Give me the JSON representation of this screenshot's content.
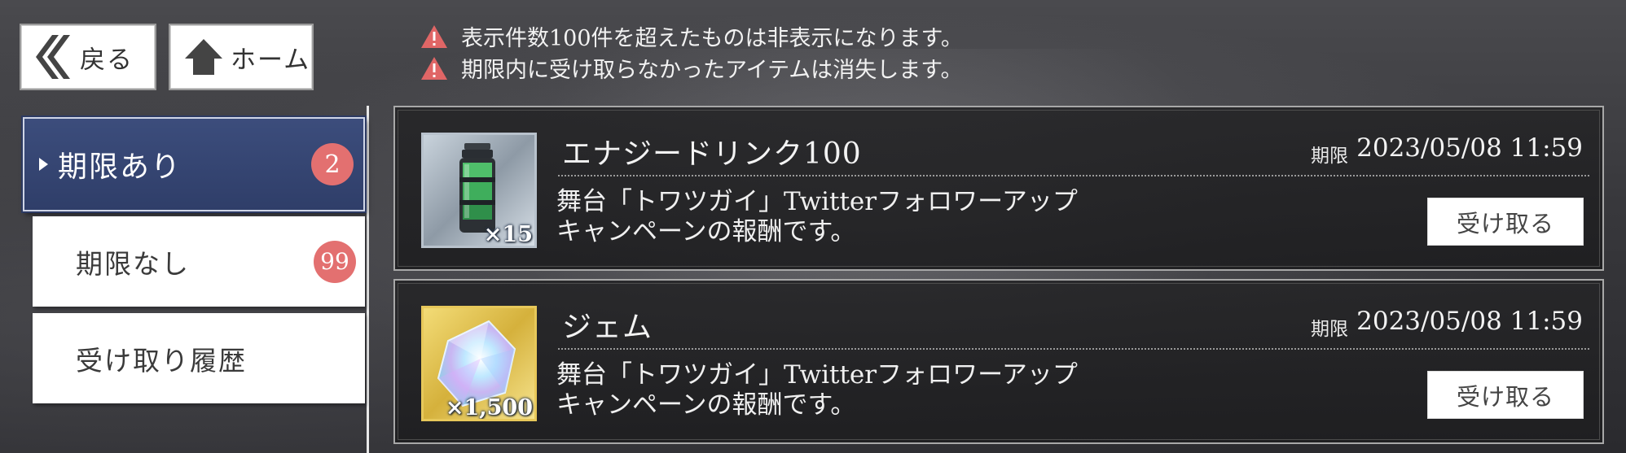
{
  "nav": {
    "back_label": "戻る",
    "home_label": "ホーム"
  },
  "notices": [
    "表示件数100件を超えたものは非表示になります。",
    "期限内に受け取らなかったアイテムは消失します。"
  ],
  "tabs": [
    {
      "label": "期限あり",
      "badge": "2",
      "active": true
    },
    {
      "label": "期限なし",
      "badge": "99",
      "active": false
    },
    {
      "label": "受け取り履歴",
      "badge": null,
      "active": false
    }
  ],
  "items": [
    {
      "name": "エナジードリンク100",
      "quantity": "×15",
      "limit_label": "期限",
      "limit_value": "2023/05/08 11:59",
      "description_line1": "舞台「トワツガイ」Twitterフォロワーアップ",
      "description_line2": "キャンペーンの報酬です。",
      "claim_label": "受け取る",
      "icon": "energy-drink-icon"
    },
    {
      "name": "ジェム",
      "quantity": "×1,500",
      "limit_label": "期限",
      "limit_value": "2023/05/08 11:59",
      "description_line1": "舞台「トワツガイ」Twitterフォロワーアップ",
      "description_line2": "キャンペーンの報酬です。",
      "claim_label": "受け取る",
      "icon": "gem-icon"
    }
  ],
  "colors": {
    "active_tab": "#34447a",
    "badge": "#e37070",
    "warning": "#e06666"
  }
}
